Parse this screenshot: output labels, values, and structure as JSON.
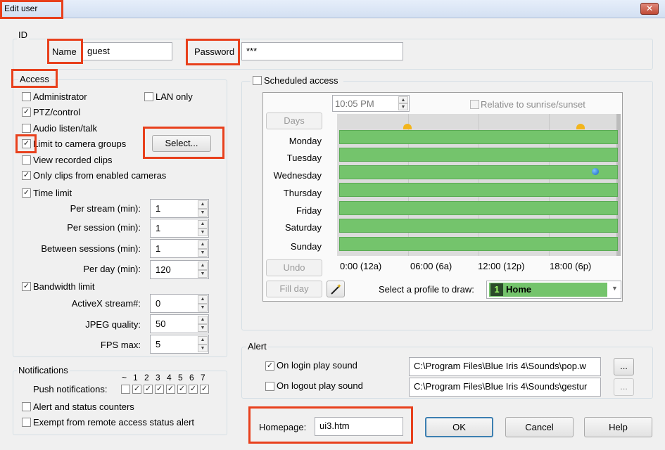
{
  "window": {
    "title": "Edit user",
    "close_glyph": "✕"
  },
  "id_section": {
    "label": "ID",
    "name_label": "Name",
    "name_value": "guest",
    "password_label": "Password",
    "password_value": "***"
  },
  "access": {
    "label": "Access",
    "administrator": {
      "label": "Administrator",
      "checked": false
    },
    "lan_only": {
      "label": "LAN only",
      "checked": false
    },
    "ptz_control": {
      "label": "PTZ/control",
      "checked": true
    },
    "audio": {
      "label": "Audio listen/talk",
      "checked": false
    },
    "limit_groups": {
      "label": "Limit to camera groups",
      "checked": true
    },
    "select_button": "Select...",
    "view_clips": {
      "label": "View recorded clips",
      "checked": false
    },
    "only_clips": {
      "label": "Only clips from enabled cameras",
      "checked": true
    },
    "time_limit": {
      "label": "Time limit",
      "checked": true
    },
    "per_stream": {
      "label": "Per stream (min):",
      "value": "1"
    },
    "per_session": {
      "label": "Per session (min):",
      "value": "1"
    },
    "between_sessions": {
      "label": "Between sessions (min):",
      "value": "1"
    },
    "per_day": {
      "label": "Per day (min):",
      "value": "120"
    },
    "bandwidth_limit": {
      "label": "Bandwidth limit",
      "checked": true
    },
    "activex": {
      "label": "ActiveX stream#:",
      "value": "0"
    },
    "jpeg_quality": {
      "label": "JPEG quality:",
      "value": "50"
    },
    "fps_max": {
      "label": "FPS max:",
      "value": "5"
    }
  },
  "notifications": {
    "label": "Notifications",
    "push_label": "Push notifications:",
    "columns": [
      "~",
      "1",
      "2",
      "3",
      "4",
      "5",
      "6",
      "7"
    ],
    "checked": [
      false,
      true,
      true,
      true,
      true,
      true,
      true,
      true
    ],
    "alert_counters": {
      "label": "Alert and status counters",
      "checked": false
    },
    "exempt": {
      "label": "Exempt from remote access status alert",
      "checked": false
    }
  },
  "schedule": {
    "label": "Scheduled access",
    "checked": false,
    "time_value": "10:05 PM",
    "relative_label": "Relative to sunrise/sunset",
    "days_button": "Days",
    "days": [
      "Monday",
      "Tuesday",
      "Wednesday",
      "Thursday",
      "Friday",
      "Saturday",
      "Sunday"
    ],
    "undo_button": "Undo",
    "fill_day_button": "Fill day",
    "time_ticks": [
      "0:00 (12a)",
      "06:00 (6a)",
      "12:00 (12p)",
      "18:00 (6p)"
    ],
    "profile_label": "Select a profile to draw:",
    "profile_value": "Home",
    "profile_icon_char": "1",
    "bar_color": "#74c46c"
  },
  "alert": {
    "label": "Alert",
    "login": {
      "label": "On login play sound",
      "checked": true,
      "path": "C:\\Program Files\\Blue Iris 4\\Sounds\\pop.w"
    },
    "logout": {
      "label": "On logout play sound",
      "checked": false,
      "path": "C:\\Program Files\\Blue Iris 4\\Sounds\\gestur"
    },
    "browse_label": "..."
  },
  "homepage": {
    "label": "Homepage:",
    "value": "ui3.htm"
  },
  "buttons": {
    "ok": "OK",
    "cancel": "Cancel",
    "help": "Help"
  },
  "colors": {
    "highlight": "#e8401c",
    "accent": "#0078d7"
  }
}
